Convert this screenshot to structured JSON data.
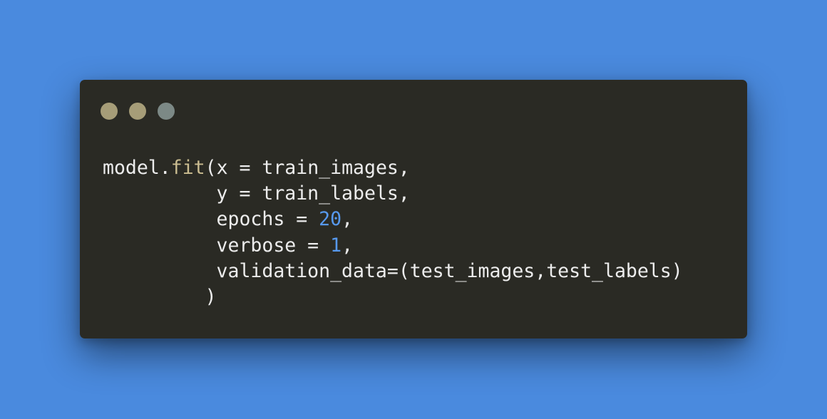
{
  "window": {
    "buttons": [
      {
        "name": "close",
        "color": "#a69d78"
      },
      {
        "name": "minimize",
        "color": "#a69d78"
      },
      {
        "name": "zoom",
        "color": "#7c8986"
      }
    ]
  },
  "syntax_colors": {
    "background": "#4a8ade",
    "window": "#2a2a24",
    "text": "#ececec",
    "function": "#cbbd91",
    "number": "#5799ee"
  },
  "code": {
    "line_1": {
      "object": "model",
      "dot": ".",
      "function": "fit",
      "args": "(x = train_images,"
    },
    "line_2": {
      "text": "          y = train_labels,"
    },
    "line_3": {
      "prefix": "          epochs = ",
      "number": "20",
      "suffix": ","
    },
    "line_4": {
      "prefix": "          verbose = ",
      "number": "1",
      "suffix": ","
    },
    "line_5": {
      "text": "          validation_data=(test_images,test_labels)"
    },
    "line_6": {
      "text": "         )"
    }
  }
}
